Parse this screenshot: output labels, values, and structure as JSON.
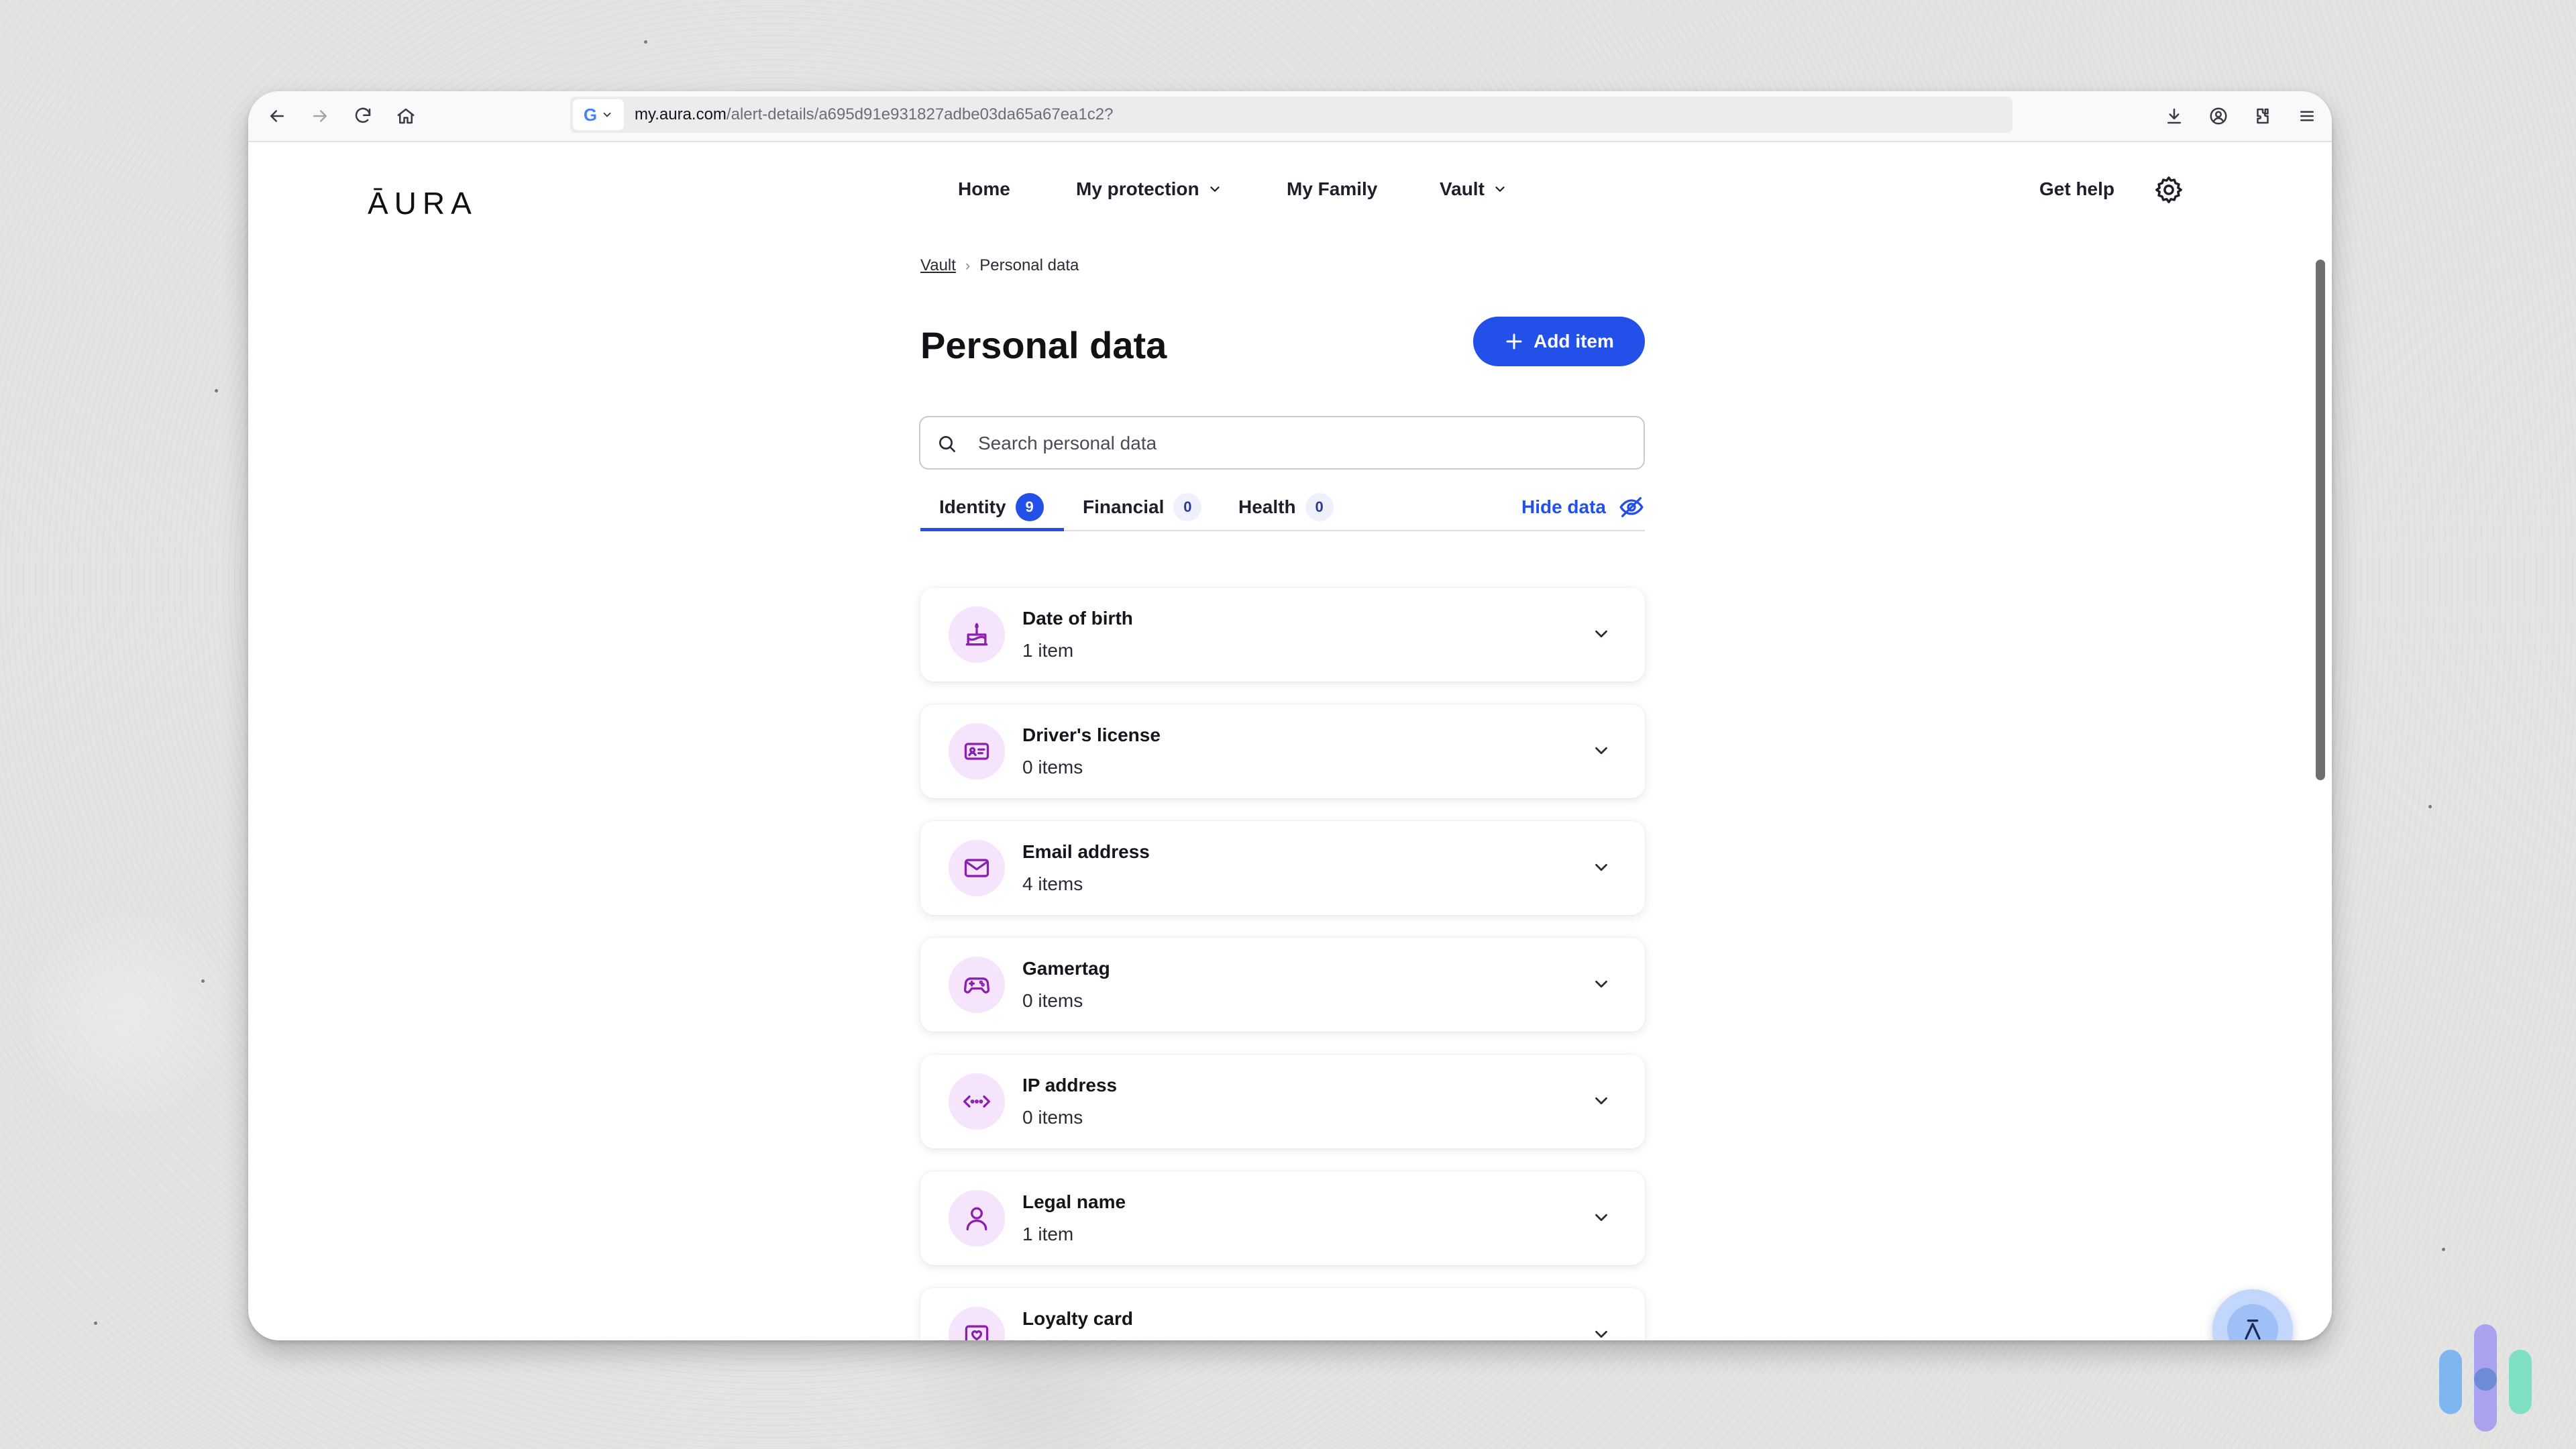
{
  "browser": {
    "url_host": "my.aura.com",
    "url_path": "/alert-details/a695d91e931827adbe03da65a67ea1c2?",
    "search_engine": "G"
  },
  "header": {
    "logo": "ĀURA",
    "nav": [
      {
        "label": "Home"
      },
      {
        "label": "My protection"
      },
      {
        "label": "My Family"
      },
      {
        "label": "Vault"
      }
    ],
    "help_label": "Get help"
  },
  "breadcrumb": {
    "parent": "Vault",
    "separator": "›",
    "current": "Personal data"
  },
  "page": {
    "title": "Personal data",
    "add_button": "Add item",
    "search_placeholder": "Search personal data"
  },
  "tabs": [
    {
      "label": "Identity",
      "count": "9",
      "active": true
    },
    {
      "label": "Financial",
      "count": "0",
      "active": false
    },
    {
      "label": "Health",
      "count": "0",
      "active": false
    }
  ],
  "hide_data_label": "Hide data",
  "categories": [
    {
      "title": "Date of birth",
      "subtitle": "1 item",
      "icon": "cake-icon"
    },
    {
      "title": "Driver's license",
      "subtitle": "0 items",
      "icon": "id-card-icon"
    },
    {
      "title": "Email address",
      "subtitle": "4 items",
      "icon": "envelope-icon"
    },
    {
      "title": "Gamertag",
      "subtitle": "0 items",
      "icon": "gamepad-icon"
    },
    {
      "title": "IP address",
      "subtitle": "0 items",
      "icon": "network-arrows-icon"
    },
    {
      "title": "Legal name",
      "subtitle": "1 item",
      "icon": "person-icon"
    },
    {
      "title": "Loyalty card",
      "subtitle": "",
      "icon": "loyalty-card-icon"
    }
  ],
  "colors": {
    "accent": "#2350e8",
    "icon_bg": "#f5e4fb",
    "icon_stroke": "#8a1fb0"
  }
}
